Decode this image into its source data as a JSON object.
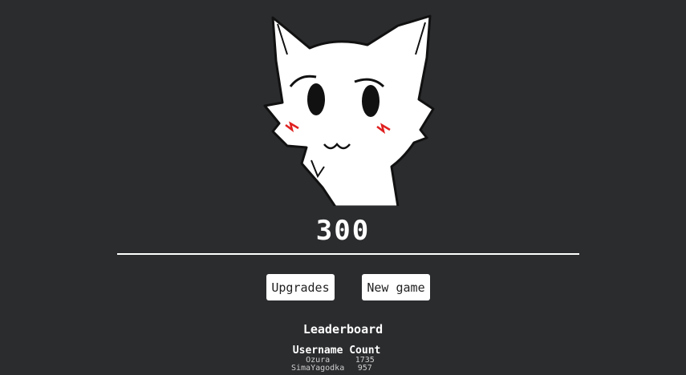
{
  "game": {
    "count": "300",
    "character": "white-fox-character"
  },
  "buttons": {
    "upgrades_label": "Upgrades",
    "new_game_label": "New game"
  },
  "leaderboard": {
    "title": "Leaderboard",
    "columns": [
      "Username",
      "Count"
    ],
    "rows": [
      {
        "username": "Ozura",
        "count": "1735"
      },
      {
        "username": "SimaYagodka",
        "count": "957"
      }
    ]
  },
  "colors": {
    "background": "#2b2c2e",
    "accent": "#ffffff",
    "blush": "#e02020"
  }
}
